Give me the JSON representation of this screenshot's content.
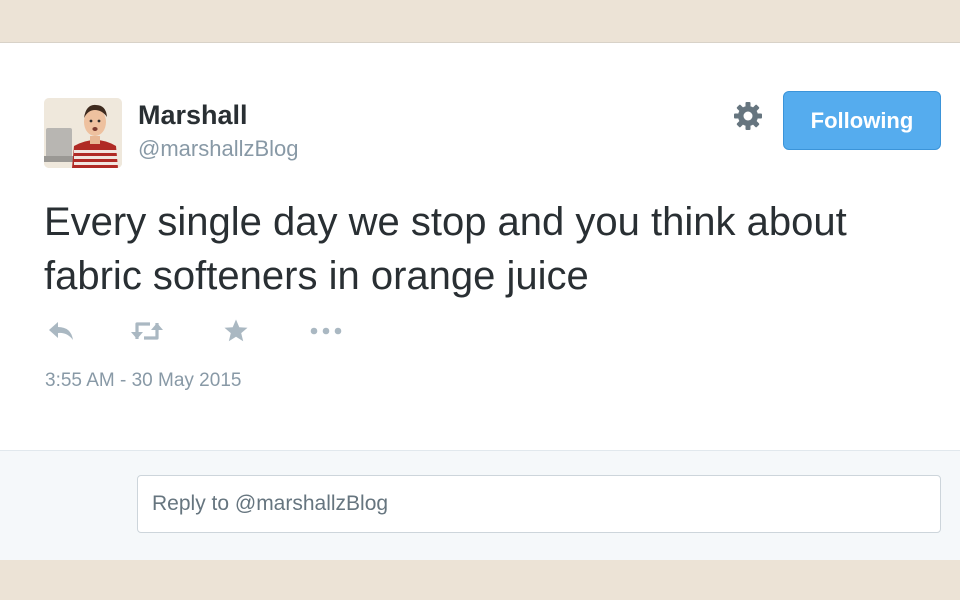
{
  "user": {
    "name": "Marshall",
    "handle": "@marshallzBlog"
  },
  "follow_button": {
    "label": "Following",
    "color": "#55acee"
  },
  "tweet": {
    "text_line1": "Every single day we stop and you think about",
    "text_line2": "fabric softeners in orange juice",
    "timestamp": "3:55 AM - 30 May 2015"
  },
  "actions": [
    {
      "icon": "reply-icon"
    },
    {
      "icon": "retweet-icon"
    },
    {
      "icon": "favorite-star-icon"
    },
    {
      "icon": "more-icon"
    }
  ],
  "reply": {
    "placeholder": "Reply to @marshallzBlog"
  },
  "colors": {
    "text": "#292f33",
    "secondary": "#8899a6",
    "icon": "#aab8c2"
  }
}
